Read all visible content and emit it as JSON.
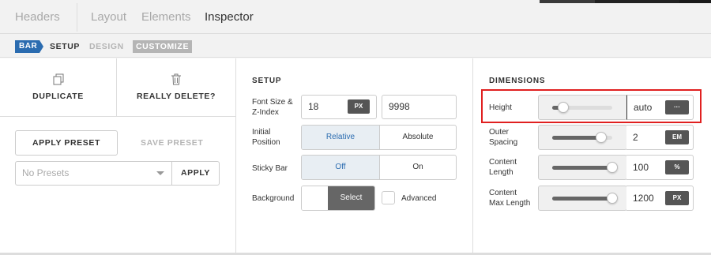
{
  "top_tabs": {
    "headers": "Headers",
    "layout": "Layout",
    "elements": "Elements",
    "inspector": "Inspector"
  },
  "subbar": {
    "badge": "BAR",
    "setup": "SETUP",
    "design": "DESIGN",
    "customize": "CUSTOMIZE"
  },
  "left": {
    "duplicate": "DUPLICATE",
    "delete": "REALLY DELETE?",
    "apply_preset": "APPLY PRESET",
    "save_preset": "SAVE PRESET",
    "preset_select": "No Presets",
    "apply": "APPLY"
  },
  "setup": {
    "title": "SETUP",
    "font_size_label_1": "Font Size &",
    "font_size_label_2": "Z-Index",
    "font_size_value": "18",
    "font_size_unit": "PX",
    "z_index_value": "9998",
    "position_label_1": "Initial",
    "position_label_2": "Position",
    "position_relative": "Relative",
    "position_absolute": "Absolute",
    "sticky_label": "Sticky Bar",
    "sticky_off": "Off",
    "sticky_on": "On",
    "background_label": "Background",
    "background_select": "Select",
    "advanced_label": "Advanced"
  },
  "dimensions": {
    "title": "DIMENSIONS",
    "height_label": "Height",
    "height_value": "auto",
    "height_unit": "···",
    "height_level": 0.18,
    "outer_label_1": "Outer",
    "outer_label_2": "Spacing",
    "outer_value": "2",
    "outer_unit": "EM",
    "outer_level": 0.82,
    "length_label_1": "Content",
    "length_label_2": "Length",
    "length_value": "100",
    "length_unit": "%",
    "length_level": 1.0,
    "max_label_1": "Content",
    "max_label_2": "Max Length",
    "max_value": "1200",
    "max_unit": "PX",
    "max_level": 1.0
  },
  "colors": {
    "accent": "#2b6cb0",
    "highlight": "#e02020",
    "dark_button": "#555555"
  },
  "icons": {
    "duplicate": "duplicate-icon",
    "delete": "trash-icon"
  }
}
